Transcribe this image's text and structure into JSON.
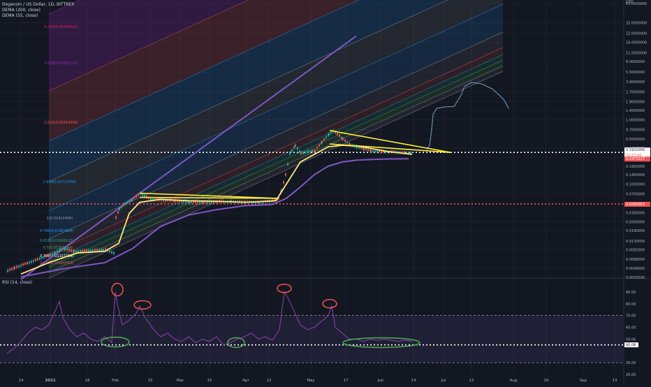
{
  "header": {
    "title": "Dogecoin / US Dollar, 1D, BITTREX",
    "indicator_1": "DEMA (200, close)",
    "indicator_2": "DEMA (55, close)",
    "rsi_label": "RSI (14, close)",
    "currency": "USD"
  },
  "colors": {
    "background": "#131722",
    "grid": "#1e222d",
    "bull": "#26a69a",
    "bear": "#ef5350",
    "dema200": "#7e57c2",
    "dema55": "#ffe97a",
    "rsi": "#8e44ad",
    "trendline": "#ffeb3b",
    "annotation_red": "#ef5350",
    "annotation_green": "#4caf50",
    "fib_band_colors": [
      "#9e9e9e",
      "#2196f3",
      "#ef5350",
      "#9c27b0"
    ]
  },
  "chart_data": [
    {
      "type": "candlestick",
      "title": "Dogecoin / US Dollar, 1D, BITTREX",
      "y_scale": "log",
      "ylim": [
        0.00355,
        64
      ],
      "x_ticks": [
        "14",
        "2021",
        "18",
        "Feb",
        "15",
        "Mar",
        "15",
        "Apr",
        "12",
        "May",
        "17",
        "Jun",
        "14",
        "Jul",
        "12",
        "Aug",
        "16",
        "Sep",
        "13"
      ],
      "y_ticks": [
        "64.0000000",
        "32.0000000",
        "22.0000000",
        "16.0000000",
        "11.0000000",
        "8.0000000",
        "5.5000000",
        "3.9000000",
        "2.7000000",
        "1.9000000",
        "1.4000000",
        "1.0000000",
        "0.7000000",
        "0.5000000",
        "0.3600000",
        "0.2600000",
        "0.1900000",
        "0.1400000",
        "0.1000000",
        "0.0700000",
        "0.0500000",
        "0.0360000",
        "0.0260000",
        "0.0190000",
        "0.0130000",
        "0.0095000",
        "0.0068000",
        "0.0049000",
        "0.0035500"
      ],
      "price_labels": [
        {
          "value": "0.3101000",
          "sub": "02:27:00",
          "color": "#131722"
        },
        {
          "value": "0.2473227",
          "color": "#ef5350"
        },
        {
          "value": "0.0490953",
          "color": "#ef5350"
        }
      ],
      "horizontal_levels": [
        0.3101,
        0.0490953
      ],
      "fib_labels": [
        {
          "text": "4.236(0.09226421)",
          "color": "#e91e63"
        },
        {
          "text": "3.618(0.07931121)",
          "color": "#9c27b0"
        },
        {
          "text": "2.618(0.05819456)",
          "color": "#ef5350"
        },
        {
          "text": "1.618(0.03713795)",
          "color": "#2196f3"
        },
        {
          "text": "1(0.02412496)",
          "color": "#9e9e9e"
        },
        {
          "text": "0.786(0.01963884)",
          "color": "#2196f3"
        },
        {
          "text": "0.618(0.01608133)",
          "color": "#26a69a"
        },
        {
          "text": "0.5(0.01359664)",
          "color": "#4caf50"
        },
        {
          "text": "0.382(0.01111194)",
          "color": "#ffffff"
        },
        {
          "text": "0.236(0.00803769)",
          "color": "#ef5350"
        }
      ],
      "price_path": [
        [
          0,
          0.0045
        ],
        [
          10,
          0.005
        ],
        [
          22,
          0.0056
        ],
        [
          34,
          0.0062
        ],
        [
          46,
          0.007
        ],
        [
          58,
          0.0078
        ],
        [
          68,
          0.0085
        ],
        [
          75,
          0.0095
        ],
        [
          82,
          0.0098
        ],
        [
          95,
          0.009
        ],
        [
          110,
          0.0092
        ],
        [
          125,
          0.0094
        ],
        [
          140,
          0.0096
        ],
        [
          152,
          0.0085
        ],
        [
          155,
          0.03
        ],
        [
          160,
          0.041
        ],
        [
          168,
          0.05
        ],
        [
          178,
          0.057
        ],
        [
          190,
          0.072
        ],
        [
          205,
          0.058
        ],
        [
          220,
          0.057
        ],
        [
          240,
          0.055
        ],
        [
          260,
          0.053
        ],
        [
          280,
          0.052
        ],
        [
          300,
          0.053
        ],
        [
          320,
          0.054
        ],
        [
          340,
          0.053
        ],
        [
          360,
          0.052
        ],
        [
          380,
          0.055
        ],
        [
          388,
          0.06
        ],
        [
          392,
          0.08
        ],
        [
          398,
          0.14
        ],
        [
          404,
          0.3
        ],
        [
          412,
          0.4
        ],
        [
          420,
          0.3
        ],
        [
          430,
          0.32
        ],
        [
          440,
          0.33
        ],
        [
          450,
          0.45
        ],
        [
          460,
          0.6
        ],
        [
          466,
          0.68
        ],
        [
          472,
          0.6
        ],
        [
          480,
          0.5
        ],
        [
          490,
          0.41
        ],
        [
          500,
          0.38
        ],
        [
          510,
          0.35
        ],
        [
          520,
          0.33
        ],
        [
          535,
          0.32
        ],
        [
          550,
          0.32
        ],
        [
          565,
          0.31
        ],
        [
          580,
          0.305
        ]
      ],
      "dema55_path": [
        [
          20,
          0.004
        ],
        [
          60,
          0.006
        ],
        [
          100,
          0.0085
        ],
        [
          140,
          0.009
        ],
        [
          160,
          0.012
        ],
        [
          175,
          0.035
        ],
        [
          190,
          0.052
        ],
        [
          220,
          0.058
        ],
        [
          260,
          0.055
        ],
        [
          300,
          0.054
        ],
        [
          340,
          0.052
        ],
        [
          385,
          0.055
        ],
        [
          400,
          0.1
        ],
        [
          420,
          0.22
        ],
        [
          440,
          0.29
        ],
        [
          460,
          0.38
        ],
        [
          480,
          0.4
        ],
        [
          500,
          0.39
        ],
        [
          520,
          0.36
        ],
        [
          545,
          0.32
        ],
        [
          580,
          0.29
        ]
      ],
      "dema200_path": [
        [
          20,
          0.0036
        ],
        [
          80,
          0.0048
        ],
        [
          140,
          0.006
        ],
        [
          180,
          0.01
        ],
        [
          220,
          0.022
        ],
        [
          260,
          0.033
        ],
        [
          300,
          0.04
        ],
        [
          340,
          0.046
        ],
        [
          380,
          0.048
        ],
        [
          400,
          0.06
        ],
        [
          420,
          0.09
        ],
        [
          440,
          0.14
        ],
        [
          460,
          0.19
        ],
        [
          480,
          0.22
        ],
        [
          500,
          0.235
        ],
        [
          520,
          0.24
        ],
        [
          545,
          0.245
        ],
        [
          575,
          0.247
        ]
      ],
      "projection_path": [
        [
          610,
          0.33
        ],
        [
          615,
          0.4
        ],
        [
          618,
          0.7
        ],
        [
          620,
          1.2
        ],
        [
          625,
          1.5
        ],
        [
          640,
          1.6
        ],
        [
          650,
          1.6
        ],
        [
          660,
          2.4
        ],
        [
          665,
          3.3
        ],
        [
          675,
          3.8
        ],
        [
          690,
          3.6
        ],
        [
          705,
          3.0
        ],
        [
          715,
          2.4
        ],
        [
          722,
          2.0
        ],
        [
          728,
          1.5
        ]
      ],
      "trendlines": [
        {
          "from": [
            190,
            0.072
          ],
          "to": [
            388,
            0.06
          ]
        },
        {
          "from": [
            190,
            0.062
          ],
          "to": [
            388,
            0.06
          ]
        },
        {
          "from": [
            462,
            0.68
          ],
          "to": [
            635,
            0.31
          ]
        },
        {
          "from": [
            462,
            0.42
          ],
          "to": [
            635,
            0.31
          ]
        },
        {
          "from": [
            20,
            0.0033
          ],
          "to": [
            500,
            20
          ]
        }
      ]
    },
    {
      "type": "line",
      "title": "RSI (14, close)",
      "ylim": [
        20,
        100
      ],
      "y_ticks": [
        "90.00",
        "80.00",
        "70.00",
        "60.00",
        "50.00",
        "45.08",
        "30.00",
        "20.00"
      ],
      "levels": [
        70,
        30,
        45.08
      ],
      "values": [
        [
          0,
          38
        ],
        [
          10,
          42
        ],
        [
          20,
          48
        ],
        [
          30,
          55
        ],
        [
          40,
          60
        ],
        [
          50,
          58
        ],
        [
          60,
          62
        ],
        [
          70,
          75
        ],
        [
          75,
          82
        ],
        [
          80,
          68
        ],
        [
          90,
          58
        ],
        [
          100,
          52
        ],
        [
          110,
          55
        ],
        [
          120,
          50
        ],
        [
          130,
          48
        ],
        [
          140,
          52
        ],
        [
          150,
          47
        ],
        [
          155,
          90
        ],
        [
          158,
          80
        ],
        [
          165,
          62
        ],
        [
          175,
          66
        ],
        [
          185,
          72
        ],
        [
          190,
          78
        ],
        [
          198,
          68
        ],
        [
          210,
          58
        ],
        [
          220,
          52
        ],
        [
          230,
          55
        ],
        [
          240,
          50
        ],
        [
          250,
          48
        ],
        [
          260,
          52
        ],
        [
          270,
          47
        ],
        [
          280,
          50
        ],
        [
          290,
          48
        ],
        [
          300,
          52
        ],
        [
          310,
          45
        ],
        [
          320,
          47
        ],
        [
          330,
          50
        ],
        [
          340,
          52
        ],
        [
          350,
          55
        ],
        [
          360,
          50
        ],
        [
          370,
          52
        ],
        [
          380,
          49
        ],
        [
          390,
          58
        ],
        [
          397,
          90
        ],
        [
          402,
          85
        ],
        [
          410,
          75
        ],
        [
          420,
          62
        ],
        [
          430,
          58
        ],
        [
          440,
          60
        ],
        [
          450,
          65
        ],
        [
          460,
          70
        ],
        [
          465,
          78
        ],
        [
          470,
          60
        ],
        [
          480,
          55
        ],
        [
          490,
          50
        ],
        [
          500,
          50
        ],
        [
          510,
          48
        ],
        [
          520,
          50
        ],
        [
          530,
          49
        ],
        [
          540,
          50
        ],
        [
          550,
          49
        ],
        [
          560,
          48
        ],
        [
          570,
          49
        ],
        [
          580,
          48
        ]
      ],
      "annotations_red": [
        [
          158,
          92
        ],
        [
          194,
          79
        ],
        [
          397,
          93
        ],
        [
          462,
          80
        ]
      ],
      "annotations_green": [
        [
          155,
          47.5
        ],
        [
          328,
          47
        ],
        [
          536,
          47
        ]
      ]
    }
  ]
}
